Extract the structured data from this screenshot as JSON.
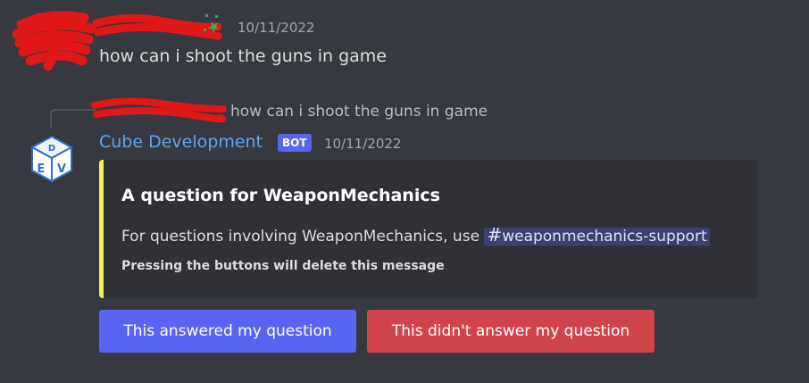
{
  "message1": {
    "timestamp": "10/11/2022",
    "content": "how can i shoot the guns in game"
  },
  "reply": {
    "referenced_content": "how can i shoot the guns in game"
  },
  "bot_message": {
    "author": "Cube Development",
    "badge": "BOT",
    "timestamp": "10/11/2022",
    "embed": {
      "title": "A question for WeaponMechanics",
      "description_prefix": "For questions involving WeaponMechanics, use",
      "channel_hash": "#",
      "channel": "weaponmechanics-support",
      "note": "Pressing the buttons will delete this message",
      "accent_color": "#f2f256"
    },
    "buttons": {
      "answered": "This answered my question",
      "not_answered": "This didn't answer my question"
    }
  },
  "colors": {
    "background": "#36393f",
    "blurple": "#5865f2",
    "danger": "#d0454a",
    "author": "#5aa6f0"
  },
  "icons": [
    "redaction-scribble",
    "nitro-sparkle-icon",
    "dev-cube-avatar"
  ]
}
